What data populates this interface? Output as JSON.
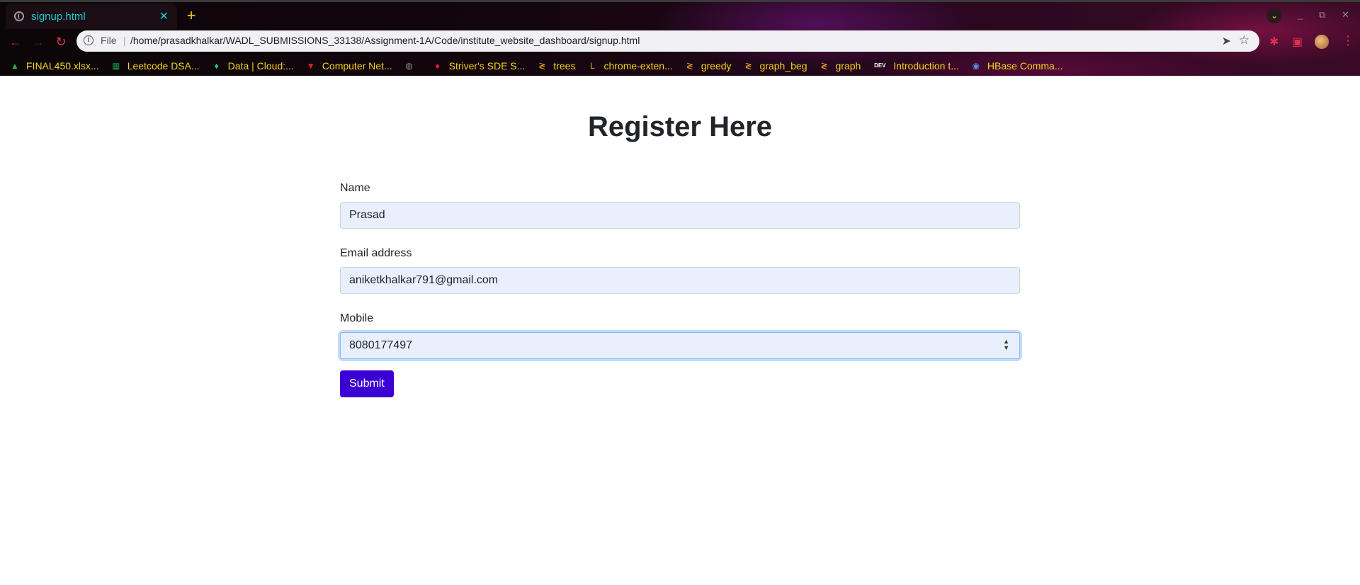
{
  "browser": {
    "tab": {
      "title": "signup.html",
      "close": "✕"
    },
    "new_tab": "+",
    "window_controls": {
      "minimize": "_",
      "restore": "⧉",
      "close": "✕"
    },
    "tab_search": "⌄",
    "nav": {
      "back": "←",
      "forward": "→",
      "reload": "↻"
    },
    "omnibox": {
      "info": "i",
      "scheme_label": "File",
      "separator": "|",
      "url": "/home/prasadkhalkar/WADL_SUBMISSIONS_33138/Assignment-1A/Code/institute_website_dashboard/signup.html",
      "send": "➤",
      "star": "☆"
    },
    "bookmarks": [
      {
        "label": "FINAL450.xlsx...",
        "icon": "drive-icon",
        "glyph": "▲",
        "color": "#34a853"
      },
      {
        "label": "Leetcode DSA...",
        "icon": "sheets-icon",
        "glyph": "▦",
        "color": "#1e8e3e"
      },
      {
        "label": "Data | Cloud:...",
        "icon": "leaf-icon",
        "glyph": "♦",
        "color": "#21c98a"
      },
      {
        "label": "Computer Net...",
        "icon": "v-icon",
        "glyph": "▼",
        "color": "#e0202a"
      },
      {
        "label": "",
        "icon": "globe-icon",
        "glyph": "◍",
        "color": "#888888"
      },
      {
        "label": "Striver's SDE S...",
        "icon": "tuf-icon",
        "glyph": "●",
        "color": "#e0202a"
      },
      {
        "label": "trees",
        "icon": "code-icon",
        "glyph": "≷",
        "color": "#f5a623"
      },
      {
        "label": "chrome-exten...",
        "icon": "lc-icon",
        "glyph": "L",
        "color": "#f5a623"
      },
      {
        "label": "greedy",
        "icon": "code-icon",
        "glyph": "≷",
        "color": "#f5a623"
      },
      {
        "label": "graph_beg",
        "icon": "code-icon",
        "glyph": "≷",
        "color": "#f5a623"
      },
      {
        "label": "graph",
        "icon": "code-icon",
        "glyph": "≷",
        "color": "#f5a623"
      },
      {
        "label": "Introduction t...",
        "icon": "dev-icon",
        "glyph": "DEV",
        "color": "#ffffff"
      },
      {
        "label": "HBase Comma...",
        "icon": "hbase-icon",
        "glyph": "◉",
        "color": "#5b8fe0"
      }
    ]
  },
  "page": {
    "heading": "Register Here",
    "name": {
      "label": "Name",
      "value": "Prasad"
    },
    "email": {
      "label": "Email address",
      "value": "aniketkhalkar791@gmail.com"
    },
    "mobile": {
      "label": "Mobile",
      "value": "8080177497"
    },
    "submit_label": "Submit"
  },
  "colors": {
    "accent": "#3b00d4",
    "tab_text": "#21c9d4",
    "bookmark_text": "#f5d020",
    "input_bg": "#e8f0fe"
  }
}
